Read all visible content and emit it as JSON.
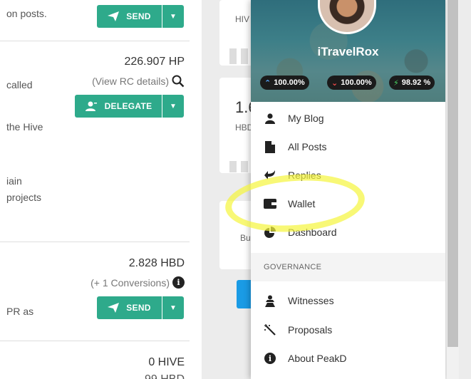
{
  "wallet": {
    "row1": {
      "desc": "on posts.",
      "button": "SEND"
    },
    "row2": {
      "amount": "226.907 HP",
      "sub": "(View RC details)",
      "desc_lines": [
        "called",
        "the Hive",
        "iain",
        "projects"
      ],
      "button": "DELEGATE"
    },
    "row3": {
      "amount": "2.828 HBD",
      "sub": "(+ 1 Conversions)",
      "desc": "PR as",
      "button": "SEND"
    },
    "row4": {
      "amount": "0 HIVE",
      "sub_partial": "99 HBD"
    }
  },
  "middle": {
    "card1": {
      "small": "HIV"
    },
    "card2": {
      "big": "1.6",
      "small": "HBD"
    },
    "card3": {
      "small": "Bu"
    }
  },
  "profile": {
    "username": "iTravelRox",
    "upvote": "100.00%",
    "downvote": "100.00%",
    "rc": "98.92 %"
  },
  "menu": {
    "items": [
      {
        "label": "My Blog",
        "icon": "user-icon"
      },
      {
        "label": "All Posts",
        "icon": "file-icon"
      },
      {
        "label": "Replies",
        "icon": "reply-icon"
      },
      {
        "label": "Wallet",
        "icon": "wallet-icon"
      },
      {
        "label": "Dashboard",
        "icon": "pie-chart-icon"
      }
    ],
    "section": "GOVERNANCE",
    "gov_items": [
      {
        "label": "Witnesses",
        "icon": "witness-icon"
      },
      {
        "label": "Proposals",
        "icon": "magic-wand-icon"
      },
      {
        "label": "About PeakD",
        "icon": "info-icon"
      }
    ]
  },
  "colors": {
    "accent_green": "#2eaa8b",
    "blue_button": "#1a9be5",
    "highlight": "#f5f53c"
  }
}
